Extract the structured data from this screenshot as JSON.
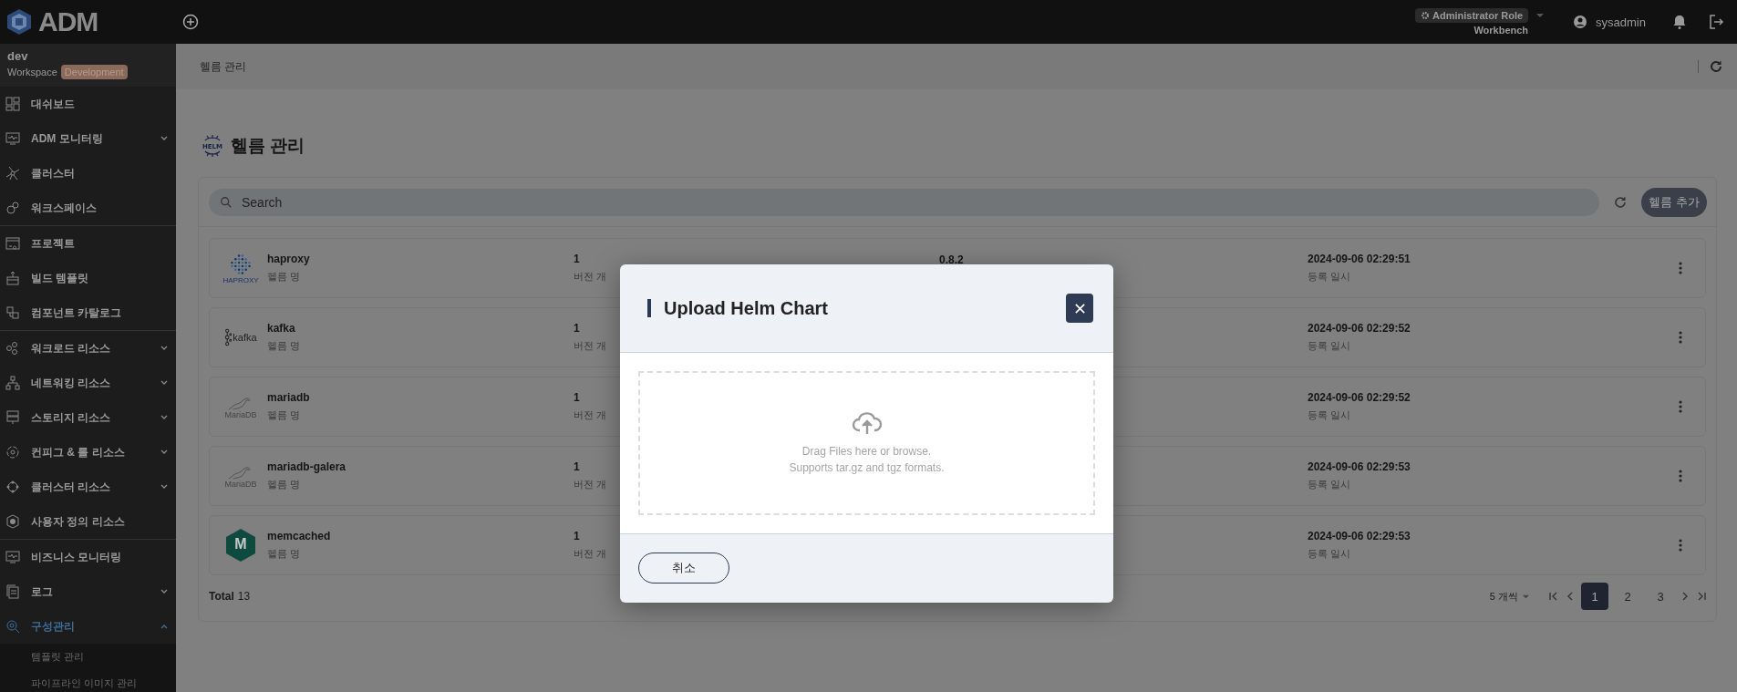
{
  "topbar": {
    "logo_text": "ADM",
    "role": {
      "label": "Administrator Role",
      "sub": "Workbench"
    },
    "user": "sysadmin"
  },
  "workspace": {
    "name": "dev",
    "label": "Workspace",
    "badge": "Development"
  },
  "sidebar": {
    "sections": [
      [
        {
          "label": "대쉬보드",
          "kind": "link"
        },
        {
          "label": "ADM 모니터링",
          "kind": "group",
          "expanded": false
        },
        {
          "label": "클러스터",
          "kind": "link"
        },
        {
          "label": "워크스페이스",
          "kind": "link"
        }
      ],
      [
        {
          "label": "프로젝트",
          "kind": "link"
        },
        {
          "label": "빌드 템플릿",
          "kind": "link"
        },
        {
          "label": "컴포넌트 카탈로그",
          "kind": "link"
        }
      ],
      [
        {
          "label": "워크로드 리소스",
          "kind": "group",
          "expanded": false
        },
        {
          "label": "네트워킹 리소스",
          "kind": "group",
          "expanded": false
        },
        {
          "label": "스토리지 리소스",
          "kind": "group",
          "expanded": false
        },
        {
          "label": "컨피그 & 롤 리소스",
          "kind": "group",
          "expanded": false
        },
        {
          "label": "클러스터 리소스",
          "kind": "group",
          "expanded": false
        },
        {
          "label": "사용자 정의 리소스",
          "kind": "link"
        }
      ],
      [
        {
          "label": "비즈니스 모니터링",
          "kind": "link"
        },
        {
          "label": "로그",
          "kind": "group",
          "expanded": false
        },
        {
          "label": "구성관리",
          "kind": "group",
          "expanded": true,
          "selected": true,
          "children": [
            {
              "label": "템플릿 관리"
            },
            {
              "label": "파이프라인 이미지 관리"
            }
          ]
        }
      ]
    ]
  },
  "breadcrumb": "헬름 관리",
  "page_title": "헬름 관리",
  "helm_icon_text": "HELM",
  "search": {
    "placeholder": "Search"
  },
  "add_button": "헬름 추가",
  "rows": [
    {
      "kind": "dots",
      "logo_text": "HAPROXY",
      "name": "haproxy",
      "name_label": "헬름 명",
      "col2": "1",
      "col2_label": "버전 개",
      "col3": "0.8.2",
      "date": "2024-09-06 02:29:51",
      "date_label": "등록 일시"
    },
    {
      "kind": "kafka",
      "logo_text": "kafka",
      "name": "kafka",
      "name_label": "헬름 명",
      "col2": "1",
      "col2_label": "버전 개",
      "date": "2024-09-06 02:29:52",
      "date_label": "등록 일시"
    },
    {
      "kind": "seal",
      "logo_text": "MariaDB",
      "name": "mariadb",
      "name_label": "헬름 명",
      "col2": "1",
      "col2_label": "버전 개",
      "date": "2024-09-06 02:29:52",
      "date_label": "등록 일시"
    },
    {
      "kind": "seal",
      "logo_text": "MariaDB",
      "name": "mariadb-galera",
      "name_label": "헬름 명",
      "col2": "1",
      "col2_label": "버전 개",
      "date": "2024-09-06 02:29:53",
      "date_label": "등록 일시"
    },
    {
      "kind": "hexagon",
      "logo_text": "M",
      "name": "memcached",
      "name_label": "헬름 명",
      "col2": "1",
      "col2_label": "버전 개",
      "date": "2024-09-06 02:29:53",
      "date_label": "등록 일시"
    }
  ],
  "footer": {
    "total_label": "Total",
    "total": "13",
    "page_size": "5 개씩",
    "pages": [
      {
        "label": "1",
        "selected": true
      },
      {
        "label": "2",
        "selected": false
      },
      {
        "label": "3",
        "selected": false
      }
    ]
  },
  "modal": {
    "title": "Upload Helm Chart",
    "drop_lines": [
      "Drag Files here or browse.",
      "Supports tar.gz and tgz formats."
    ],
    "cancel": "취소"
  }
}
